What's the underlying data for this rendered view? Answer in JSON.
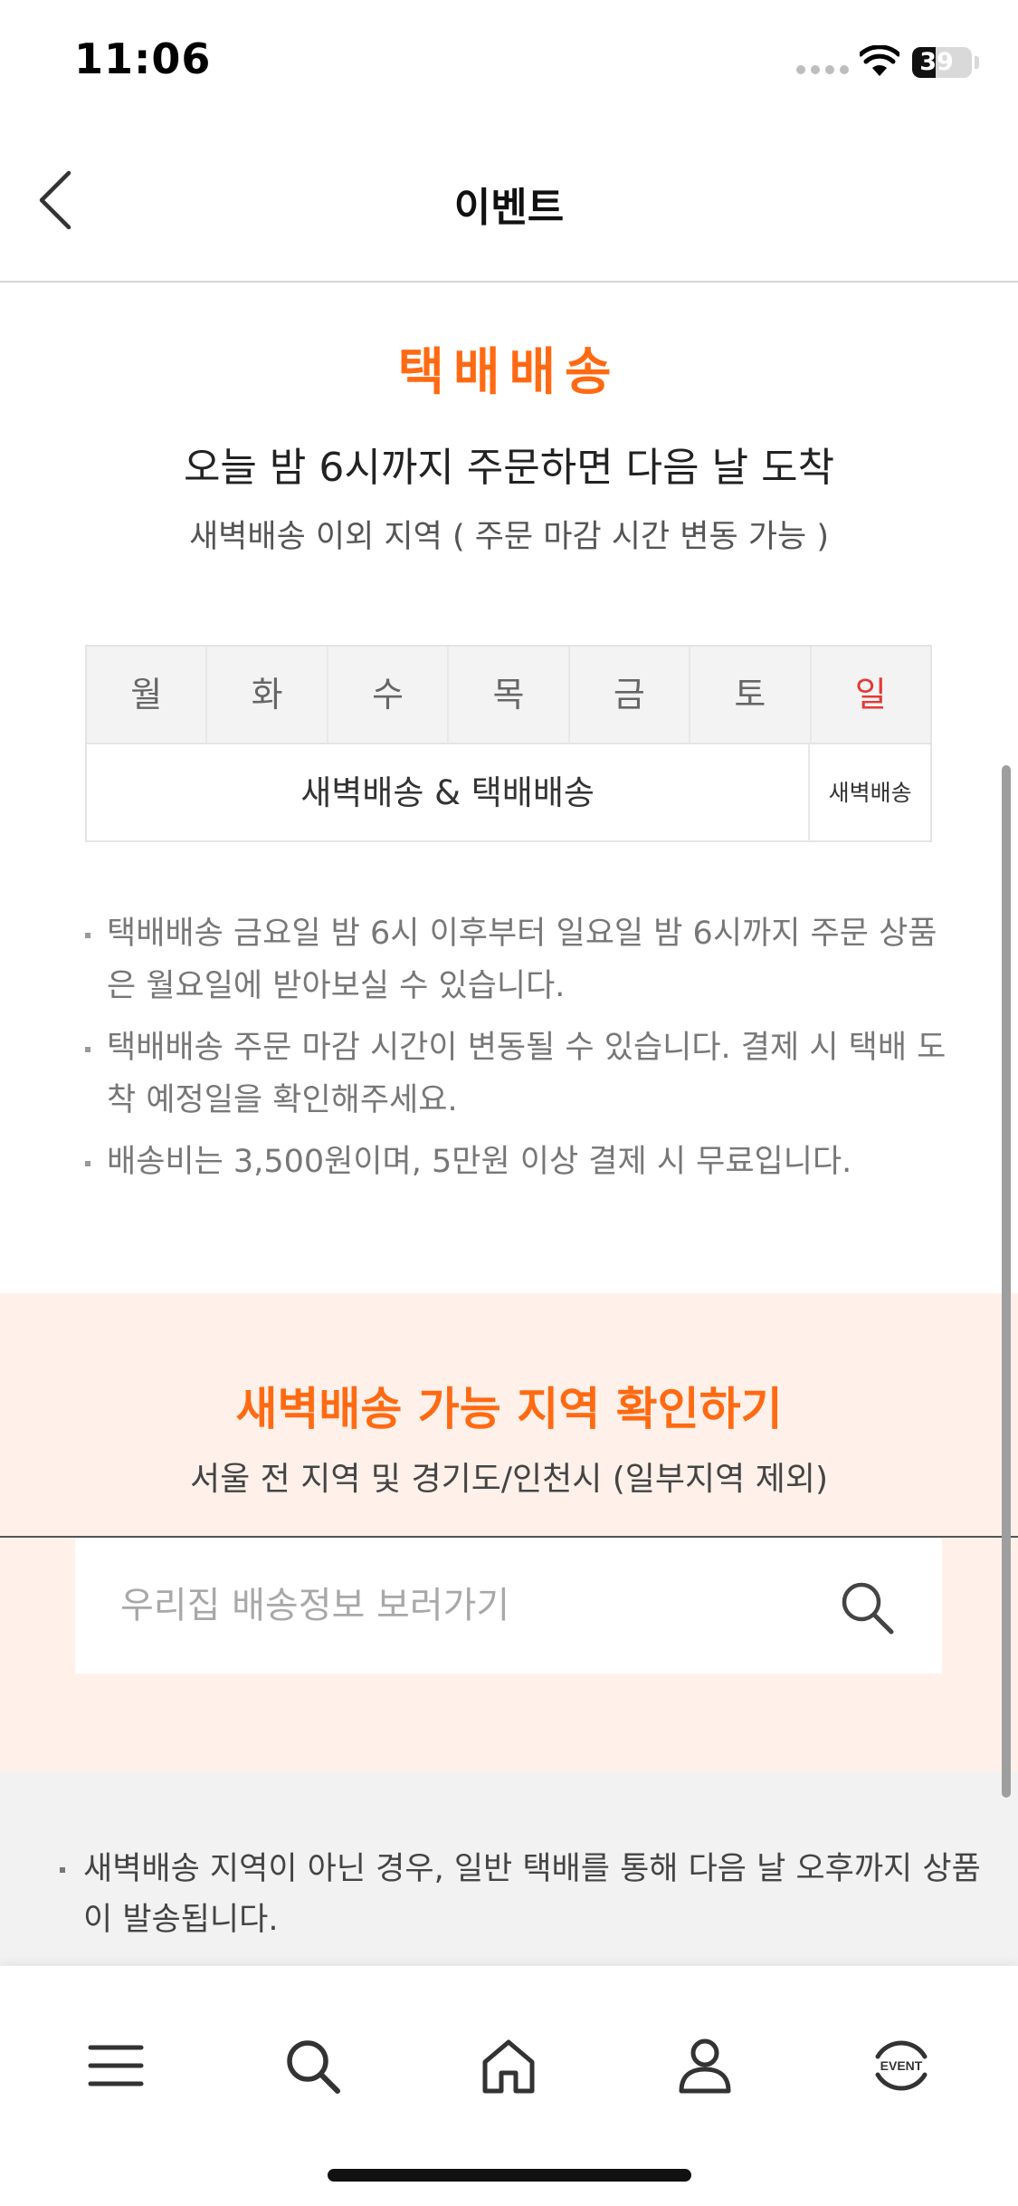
{
  "status_bar": {
    "time": "11:06",
    "battery_level": "39"
  },
  "header": {
    "title": "이벤트",
    "back_icon": "chevron-left-icon"
  },
  "parcel_section": {
    "badge": "택배배송",
    "headline": "오늘 밤 6시까지 주문하면 다음 날 도착",
    "subline": "새벽배송 이외 지역 ( 주문 마감 시간 변동 가능 )"
  },
  "schedule": {
    "days": [
      "월",
      "화",
      "수",
      "목",
      "금",
      "토",
      "일"
    ],
    "weekday_types": "새벽배송 & 택배배송",
    "sunday_type": "새벽배송",
    "sunday_color": "#e53935"
  },
  "notes": [
    "택배배송 금요일 밤 6시 이후부터 일요일 밤 6시까지 주문 상품은 월요일에 받아보실 수 있습니다.",
    "택배배송 주문 마감 시간이 변동될 수 있습니다. 결제 시 택배 도착 예정일을 확인해주세요.",
    "배송비는 3,500원이며, 5만원 이상 결제 시 무료입니다."
  ],
  "dawn_section": {
    "title": "새벽배송 가능 지역 확인하기",
    "subtitle": "서울 전 지역 및 경기도/인천시 (일부지역 제외)",
    "search_placeholder": "우리집 배송정보 보러가기",
    "accent_color": "#ff6a13",
    "background_color": "#fff1ea"
  },
  "bottom_note": "새벽배송 지역이 아닌 경우, 일반 택배를 통해 다음 날 오후까지 상품이 발송됩니다.",
  "tab_bar": {
    "items": [
      {
        "icon": "menu-icon"
      },
      {
        "icon": "search-icon"
      },
      {
        "icon": "home-icon"
      },
      {
        "icon": "user-icon"
      },
      {
        "icon": "event-icon",
        "label": "EVENT"
      }
    ]
  }
}
